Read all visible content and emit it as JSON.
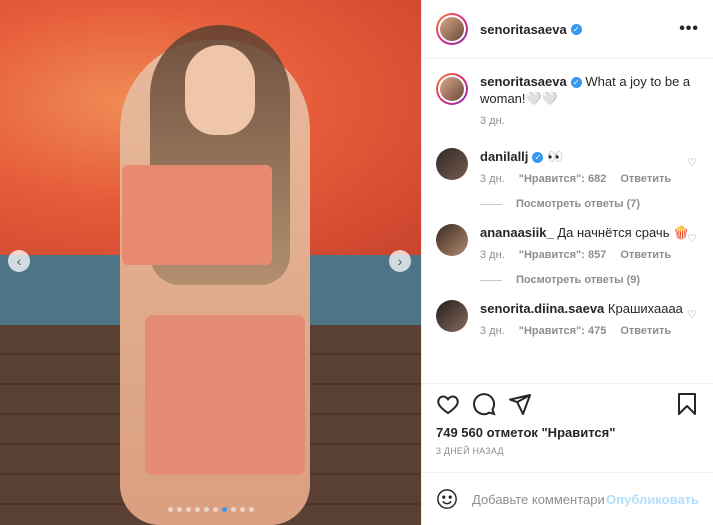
{
  "post": {
    "username": "senoritasaeva",
    "more_glyph": "•••",
    "caption": {
      "username": "senoritasaeva",
      "text": "What a joy to be a woman!🤍🤍",
      "time": "3 дн."
    },
    "carousel": {
      "total": 10,
      "active_index": 6
    },
    "comments": [
      {
        "username": "danilallj",
        "verified": true,
        "text": "👀",
        "time": "3 дн.",
        "likes": "\"Нравится\": 682",
        "reply": "Ответить",
        "view_replies": "Посмотреть ответы (7)"
      },
      {
        "username": "ananaasiik_",
        "verified": false,
        "text": "Да начнётся срачь 🍿",
        "time": "3 дн.",
        "likes": "\"Нравится\": 857",
        "reply": "Ответить",
        "view_replies": "Посмотреть ответы (9)"
      },
      {
        "username": "senorita.diina.saeva",
        "verified": false,
        "text": "Крашихаааа",
        "time": "3 дн.",
        "likes": "\"Нравится\": 475",
        "reply": "Ответить"
      }
    ],
    "likes_text": "749 560 отметок \"Нравится\"",
    "timestamp": "3 ДНЕЙ НАЗАД",
    "add_comment_placeholder": "Добавьте комментарий...",
    "publish_label": "Опубликовать",
    "icons": {
      "prev": "chevron-left-icon",
      "next": "chevron-right-icon",
      "like": "heart-icon",
      "comment": "comment-icon",
      "share": "paper-plane-icon",
      "save": "bookmark-icon",
      "emoji": "smiley-icon"
    },
    "colors": {
      "accent": "#3897f0",
      "muted": "#8e8e8e",
      "publish_disabled": "#b2dffc"
    }
  }
}
